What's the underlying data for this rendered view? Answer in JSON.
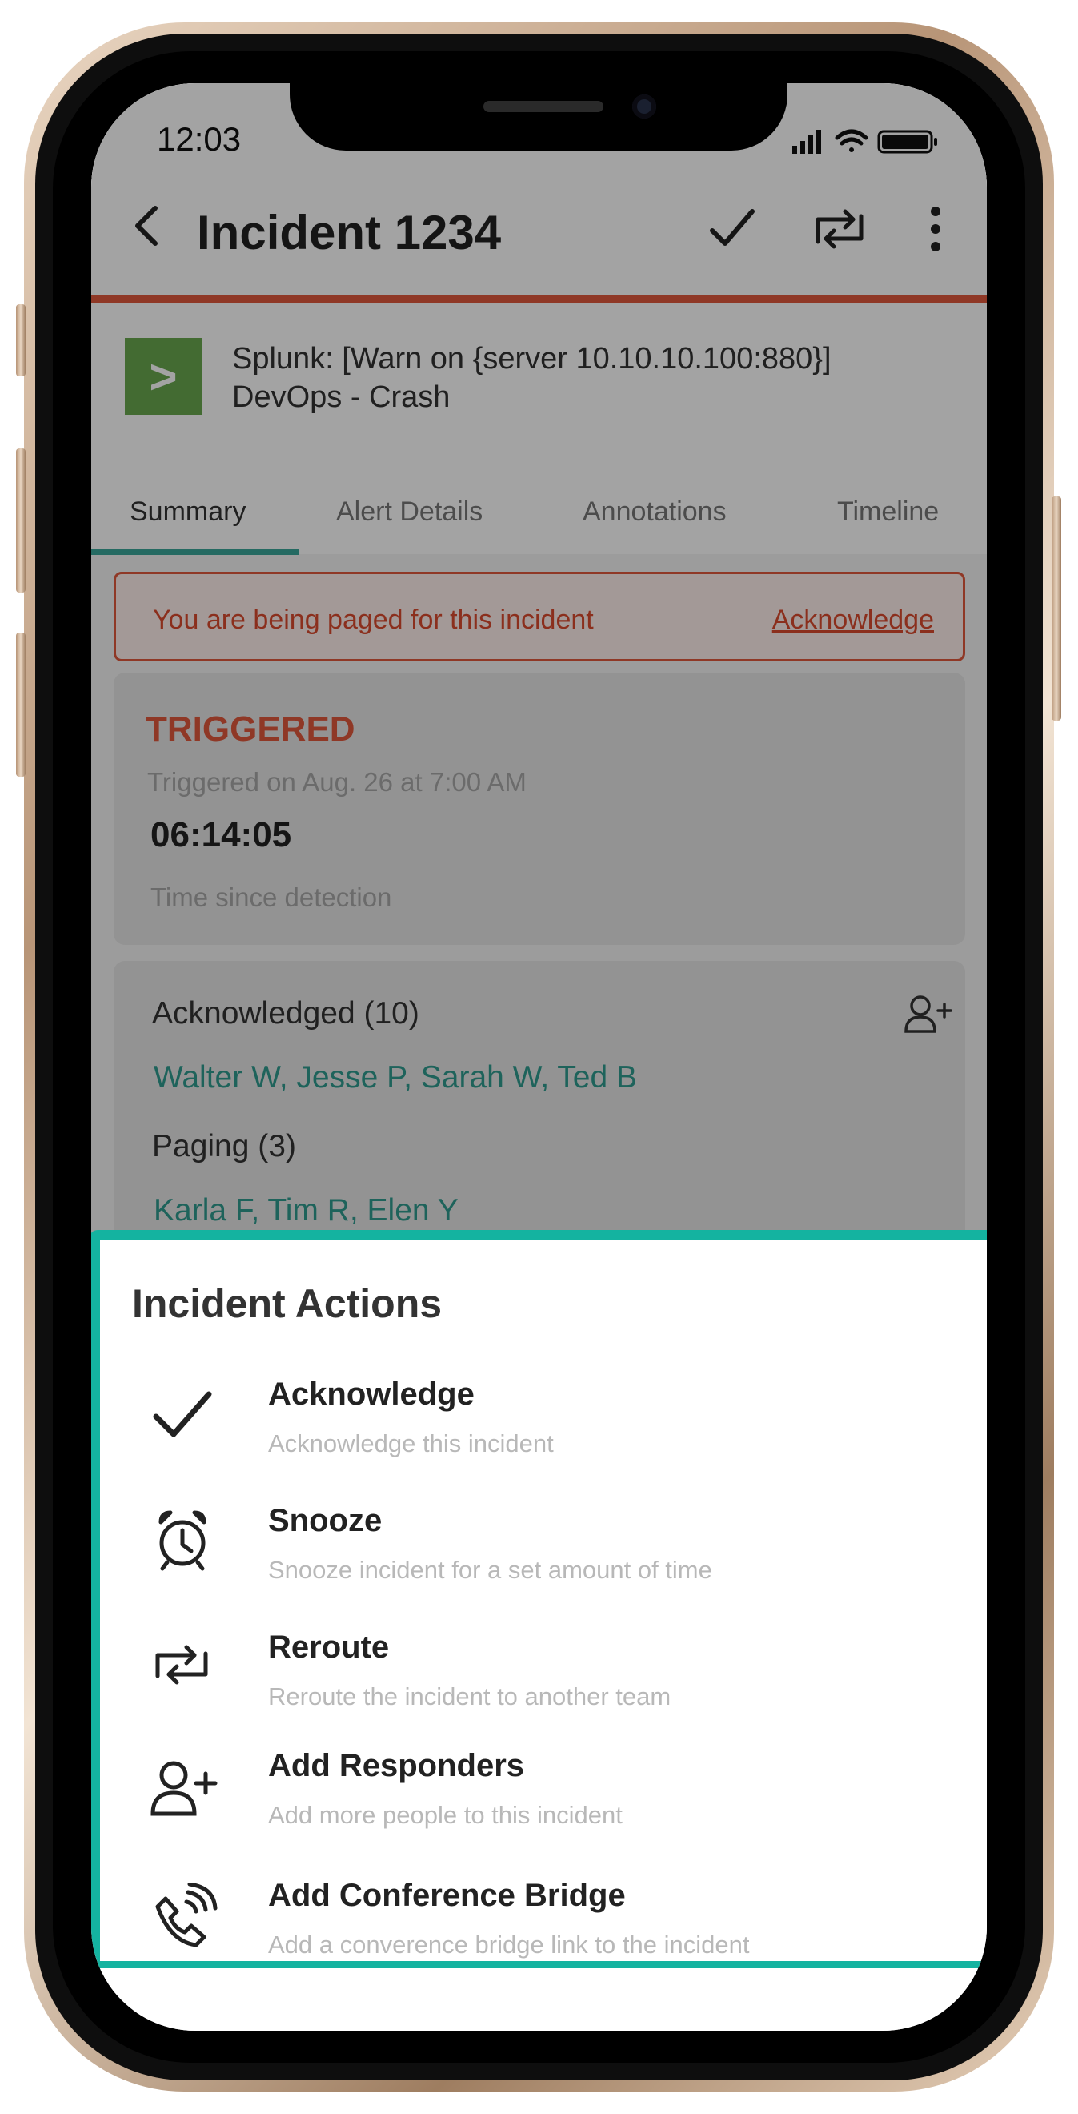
{
  "status_bar": {
    "time": "12:03"
  },
  "header": {
    "title": "Incident 1234"
  },
  "alert": {
    "logo_glyph": ">",
    "line1": "Splunk: [Warn on {server 10.10.10.100:880}]",
    "line2": "DevOps - Crash"
  },
  "tabs": [
    {
      "label": "Summary",
      "active": true
    },
    {
      "label": "Alert Details",
      "active": false
    },
    {
      "label": "Annotations",
      "active": false
    },
    {
      "label": "Timeline",
      "active": false
    }
  ],
  "page_banner": {
    "text": "You are being paged for this incident",
    "link": "Acknowledge"
  },
  "status_card": {
    "state": "TRIGGERED",
    "triggered_on": "Triggered on Aug. 26 at 7:00 AM",
    "elapsed": "06:14:05",
    "elapsed_label": "Time since detection"
  },
  "responders": {
    "acknowledged_title": "Acknowledged (10)",
    "acknowledged_names": "Walter W, Jesse P, Sarah W, Ted B",
    "paging_title": "Paging (3)",
    "paging_names": "Karla F, Tim R, Elen Y"
  },
  "sheet": {
    "title": "Incident Actions",
    "actions": [
      {
        "icon": "check-icon",
        "label": "Acknowledge",
        "desc": "Acknowledge this incident"
      },
      {
        "icon": "alarm-clock-icon",
        "label": "Snooze",
        "desc": "Snooze incident for a set amount of time"
      },
      {
        "icon": "reroute-icon",
        "label": "Reroute",
        "desc": "Reroute the incident to another team"
      },
      {
        "icon": "add-person-icon",
        "label": "Add Responders",
        "desc": "Add more people to this incident"
      },
      {
        "icon": "phone-ringing-icon",
        "label": "Add Conference Bridge",
        "desc": "Add a converence bridge link to the incident"
      }
    ]
  },
  "colors": {
    "accent": "#e0583c",
    "teal": "#2f9b8f",
    "highlight": "#14b3a0",
    "logo": "#6aa84f"
  }
}
